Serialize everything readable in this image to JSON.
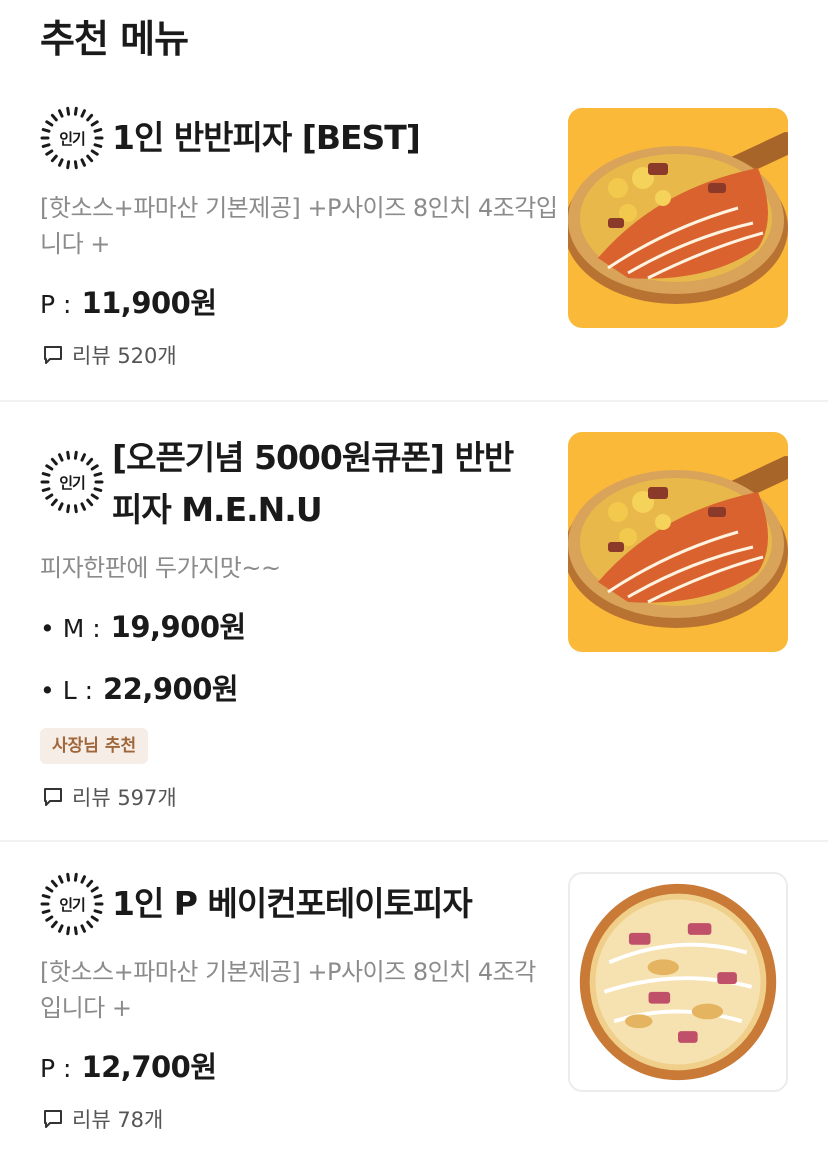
{
  "section_title": "추천 메뉴",
  "badge_label": "인기",
  "colors": {
    "accent_owner_bg": "#f5ede6",
    "accent_owner_text": "#a0673b",
    "thumb_yellow": "#fbb93a"
  },
  "items": [
    {
      "name": "1인 반반피자 [BEST]",
      "description": "[핫소스+파마산 기본제공] +P사이즈  8인치 4조각입니다 +",
      "prices": [
        {
          "label": "P :",
          "value": "11,900원"
        }
      ],
      "reviews": "리뷰 520개",
      "image": "half-half-pizza"
    },
    {
      "name": "[오픈기념 5000원큐폰] 반반피자 M.E.N.U",
      "description": "피자한판에 두가지맛~~",
      "prices": [
        {
          "label": "• M :",
          "value": "19,900원"
        },
        {
          "label": "• L :",
          "value": "22,900원"
        }
      ],
      "owner_badge": "사장님 추천",
      "reviews": "리뷰 597개",
      "image": "half-half-pizza"
    },
    {
      "name": "1인 P 베이컨포테이토피자",
      "description": "[핫소스+파마산 기본제공] +P사이즈 8인치 4조각입니다 +",
      "prices": [
        {
          "label": "P :",
          "value": "12,700원"
        }
      ],
      "reviews": "리뷰 78개",
      "image": "bacon-potato-pizza"
    }
  ]
}
